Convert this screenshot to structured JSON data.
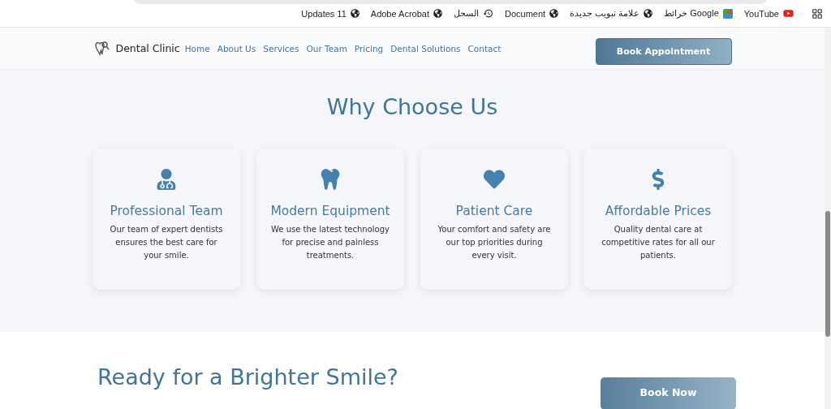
{
  "browser": {
    "bookmarks": [
      {
        "label": "Updates 11",
        "kind": "globe"
      },
      {
        "label": "Adobe Acrobat",
        "kind": "globe"
      },
      {
        "label": "السجل",
        "kind": "history"
      },
      {
        "label": "Document",
        "kind": "globe"
      },
      {
        "label": "علامة تبويب جديدة",
        "kind": "globe"
      },
      {
        "label": "خرائط Google",
        "kind": "maps"
      },
      {
        "label": "YouTube",
        "kind": "youtube"
      }
    ]
  },
  "header": {
    "brand": "Dental Clinic",
    "nav": [
      "Home",
      "About Us",
      "Services",
      "Our Team",
      "Pricing",
      "Dental Solutions",
      "Contact"
    ],
    "cta": "Book Appointment"
  },
  "features": {
    "title": "Why Choose Us",
    "cards": [
      {
        "kind": "doctor",
        "title": "Professional Team",
        "text": "Our team of expert dentists ensures the best care for your smile."
      },
      {
        "kind": "tooth",
        "title": "Modern Equipment",
        "text": "We use the latest technology for precise and painless treatments."
      },
      {
        "kind": "heart",
        "title": "Patient Care",
        "text": "Your comfort and safety are our top priorities during every visit."
      },
      {
        "kind": "dollar",
        "title": "Affordable Prices",
        "text": "Quality dental care at competitive rates for all our patients."
      }
    ]
  },
  "cta_section": {
    "title": "Ready for a Brighter Smile?",
    "button": "Book Now"
  }
}
